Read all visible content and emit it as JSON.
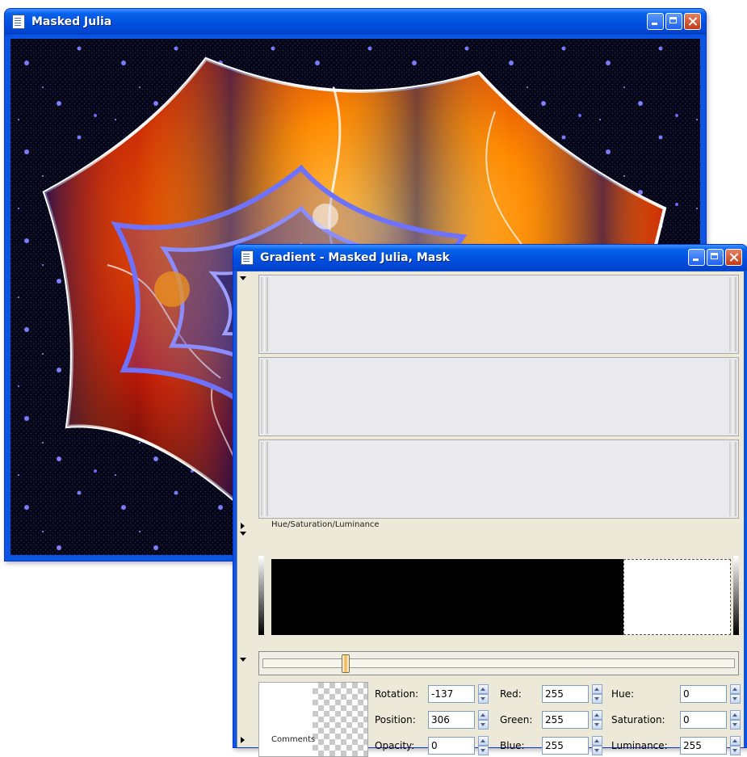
{
  "julia_window": {
    "title": "Masked Julia"
  },
  "gradient_window": {
    "title": "Gradient - Masked Julia, Mask",
    "hsl_section_label": "Hue/Saturation/Luminance",
    "comments_label": "Comments",
    "slider_position_fraction": 0.17,
    "fields": {
      "rotation": {
        "label": "Rotation:",
        "value": "-137"
      },
      "position": {
        "label": "Position:",
        "value": "306"
      },
      "opacity": {
        "label": "Opacity:",
        "value": "0"
      },
      "red": {
        "label": "Red:",
        "value": "255"
      },
      "green": {
        "label": "Green:",
        "value": "255"
      },
      "blue": {
        "label": "Blue:",
        "value": "255"
      },
      "hue": {
        "label": "Hue:",
        "value": "0"
      },
      "saturation": {
        "label": "Saturation:",
        "value": "0"
      },
      "luminance": {
        "label": "Luminance:",
        "value": "255"
      }
    }
  },
  "colors": {
    "title_bar_blue": "#0a55e4",
    "fractal_orange": "#ff8a00",
    "fractal_red": "#c01808",
    "fractal_navy": "#101060",
    "star_violet": "#7b7bff",
    "background_space": "#07071a"
  },
  "icons": [
    "document-icon",
    "minimize-icon",
    "maximize-icon",
    "close-icon",
    "spin-up-icon",
    "spin-down-icon"
  ]
}
